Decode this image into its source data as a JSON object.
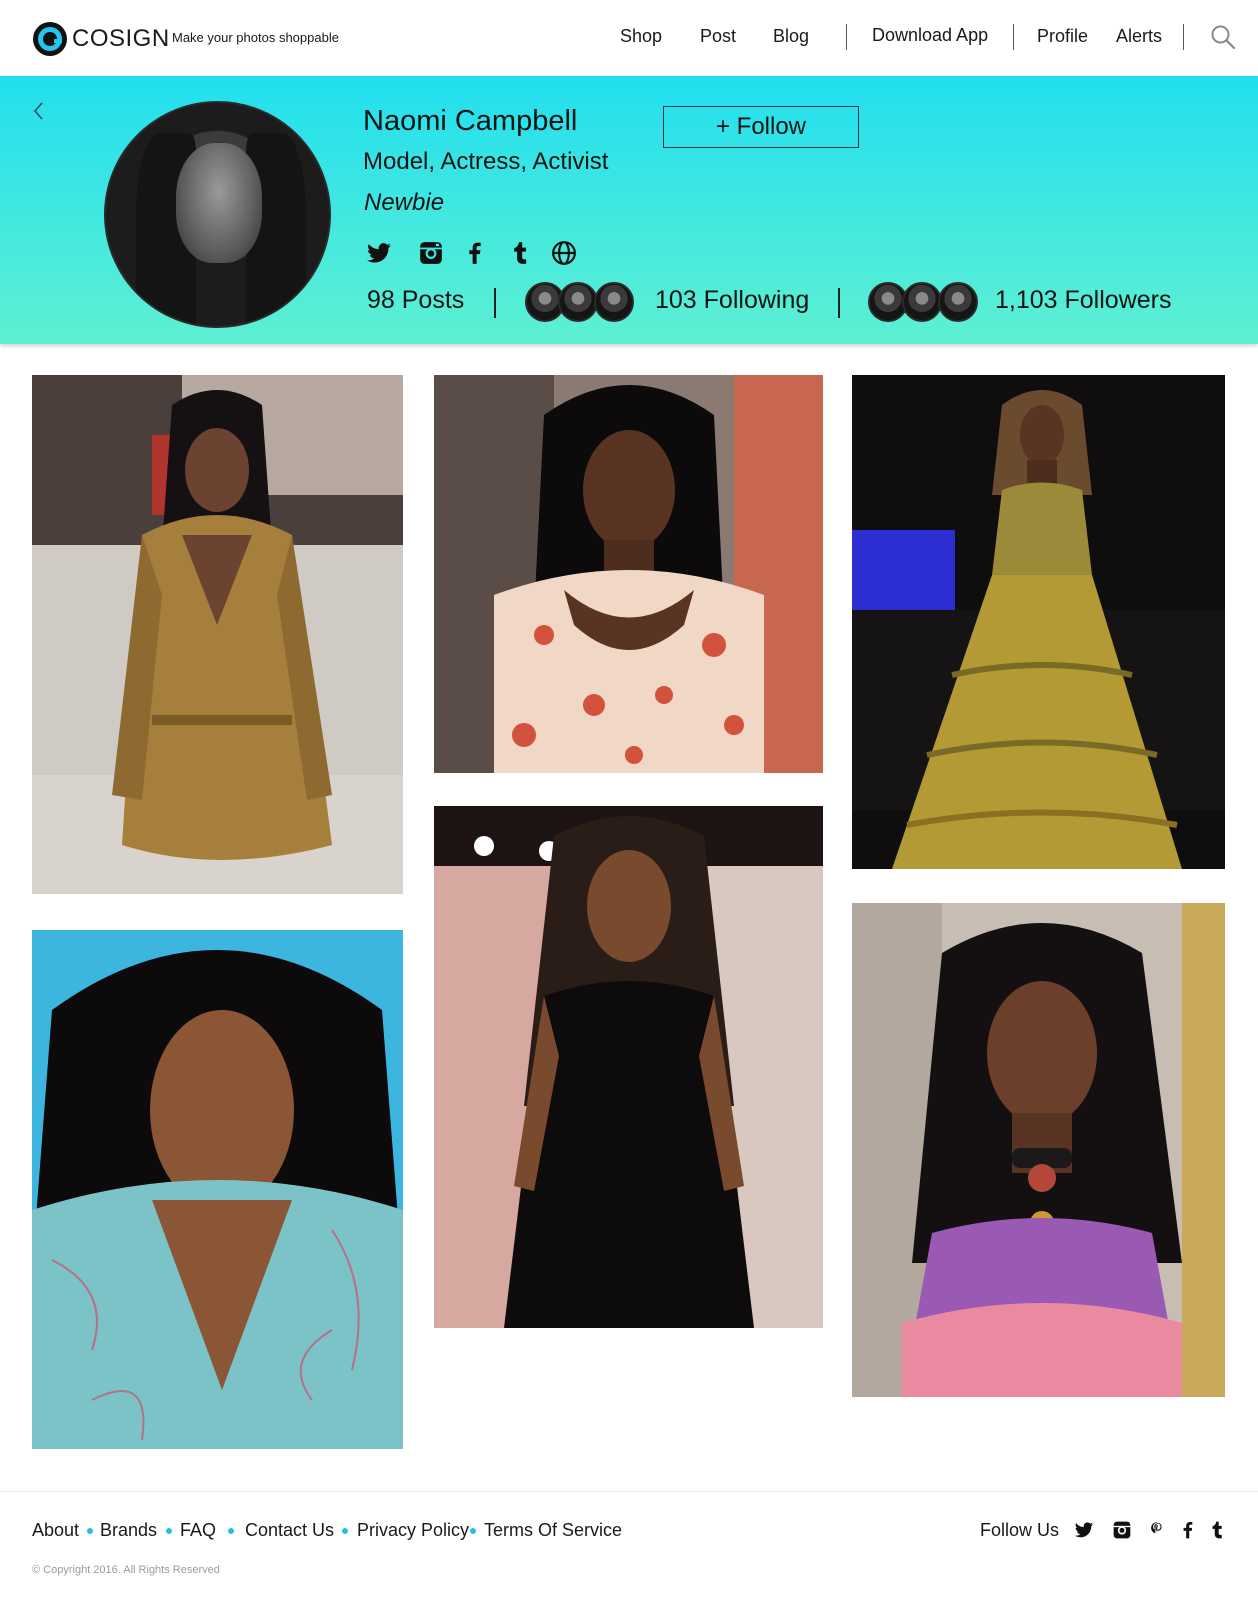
{
  "header": {
    "brand": "COSIGN",
    "tagline": "Make your photos shoppable",
    "nav": [
      "Shop",
      "Post",
      "Blog",
      "Download App",
      "Profile",
      "Alerts"
    ]
  },
  "profile": {
    "name": "Naomi Campbell",
    "title": "Model, Actress, Activist",
    "rank": "Newbie",
    "follow_label": "+ Follow",
    "posts": "98 Posts",
    "following": "103 Following",
    "followers": "1,103 Followers",
    "social_icons": [
      "twitter-icon",
      "instagram-icon",
      "facebook-icon",
      "tumblr-icon",
      "website-globe-icon"
    ]
  },
  "footer": {
    "links": [
      "About",
      "Brands",
      "FAQ",
      "Contact Us",
      "Privacy Policy",
      "Terms Of Service"
    ],
    "follow_us": "Follow Us",
    "social_icons": [
      "twitter-icon",
      "instagram-icon",
      "pinterest-icon",
      "facebook-icon",
      "tumblr-icon"
    ],
    "copyright": "© Copyright 2016. All Rights Reserved"
  },
  "colors": {
    "banner_top": "#22dfef",
    "banner_bottom": "#5ef0d2",
    "accent": "#22bfe6"
  }
}
